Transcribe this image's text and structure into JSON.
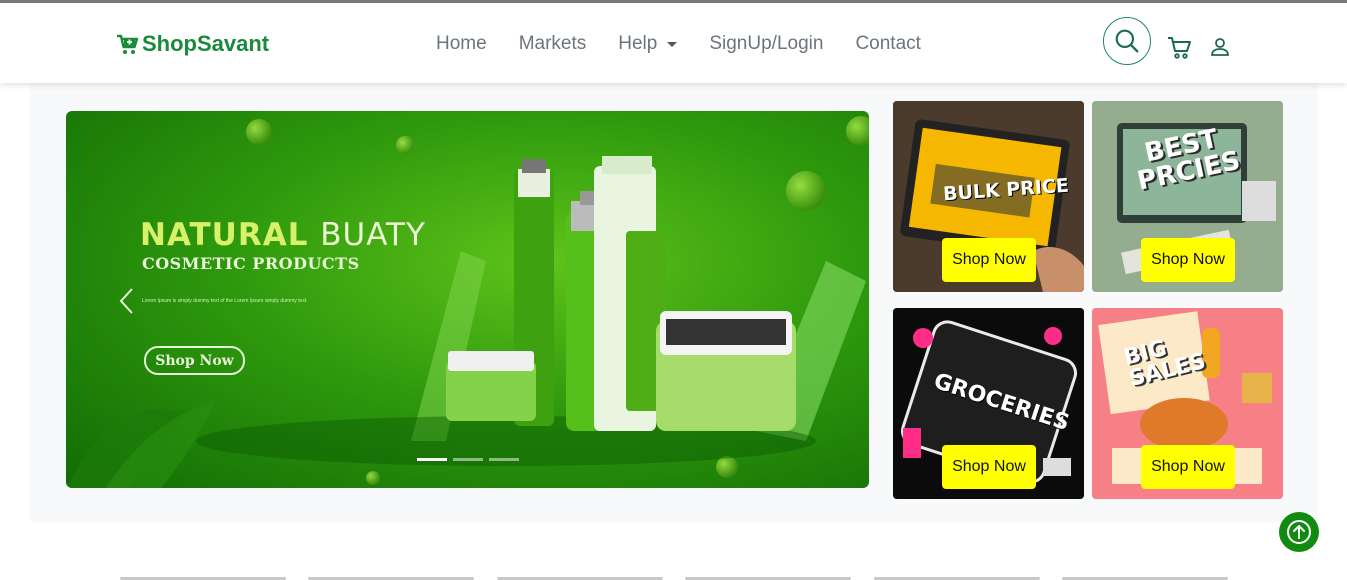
{
  "brand": {
    "name": "ShopSavant",
    "color": "#1b8a3a"
  },
  "nav": {
    "links": [
      {
        "label": "Home"
      },
      {
        "label": "Markets"
      },
      {
        "label": "Help"
      },
      {
        "label": "SignUp/Login"
      },
      {
        "label": "Contact"
      }
    ]
  },
  "header_icons": [
    "search-icon",
    "cart-icon",
    "user-icon"
  ],
  "hero": {
    "headline_part1": "NATURAL",
    "headline_part2": "BUATY",
    "subheading": "COSMETIC PRODUCTS",
    "body_text": "Lorem Ipsum is simply dummy text of the Lorem Ipsum simply dummy text",
    "cta_label": "Shop Now",
    "active_slide": 1,
    "slide_count": 3
  },
  "tiles": [
    {
      "title": "BULK PRICE",
      "button_label": "Shop Now",
      "bg": "#f5b700"
    },
    {
      "title": "BEST PRCIES",
      "button_label": "Shop Now",
      "bg": "#8fa88a"
    },
    {
      "title": "GROCERIES",
      "button_label": "Shop Now",
      "bg": "#0b0b0b"
    },
    {
      "title": "BIG SALES",
      "button_label": "Shop Now",
      "bg": "#f77f86"
    }
  ],
  "colors": {
    "accent": "#1b8a3a",
    "button_yellow": "#ffff00",
    "scroll_top": "#108a10"
  }
}
